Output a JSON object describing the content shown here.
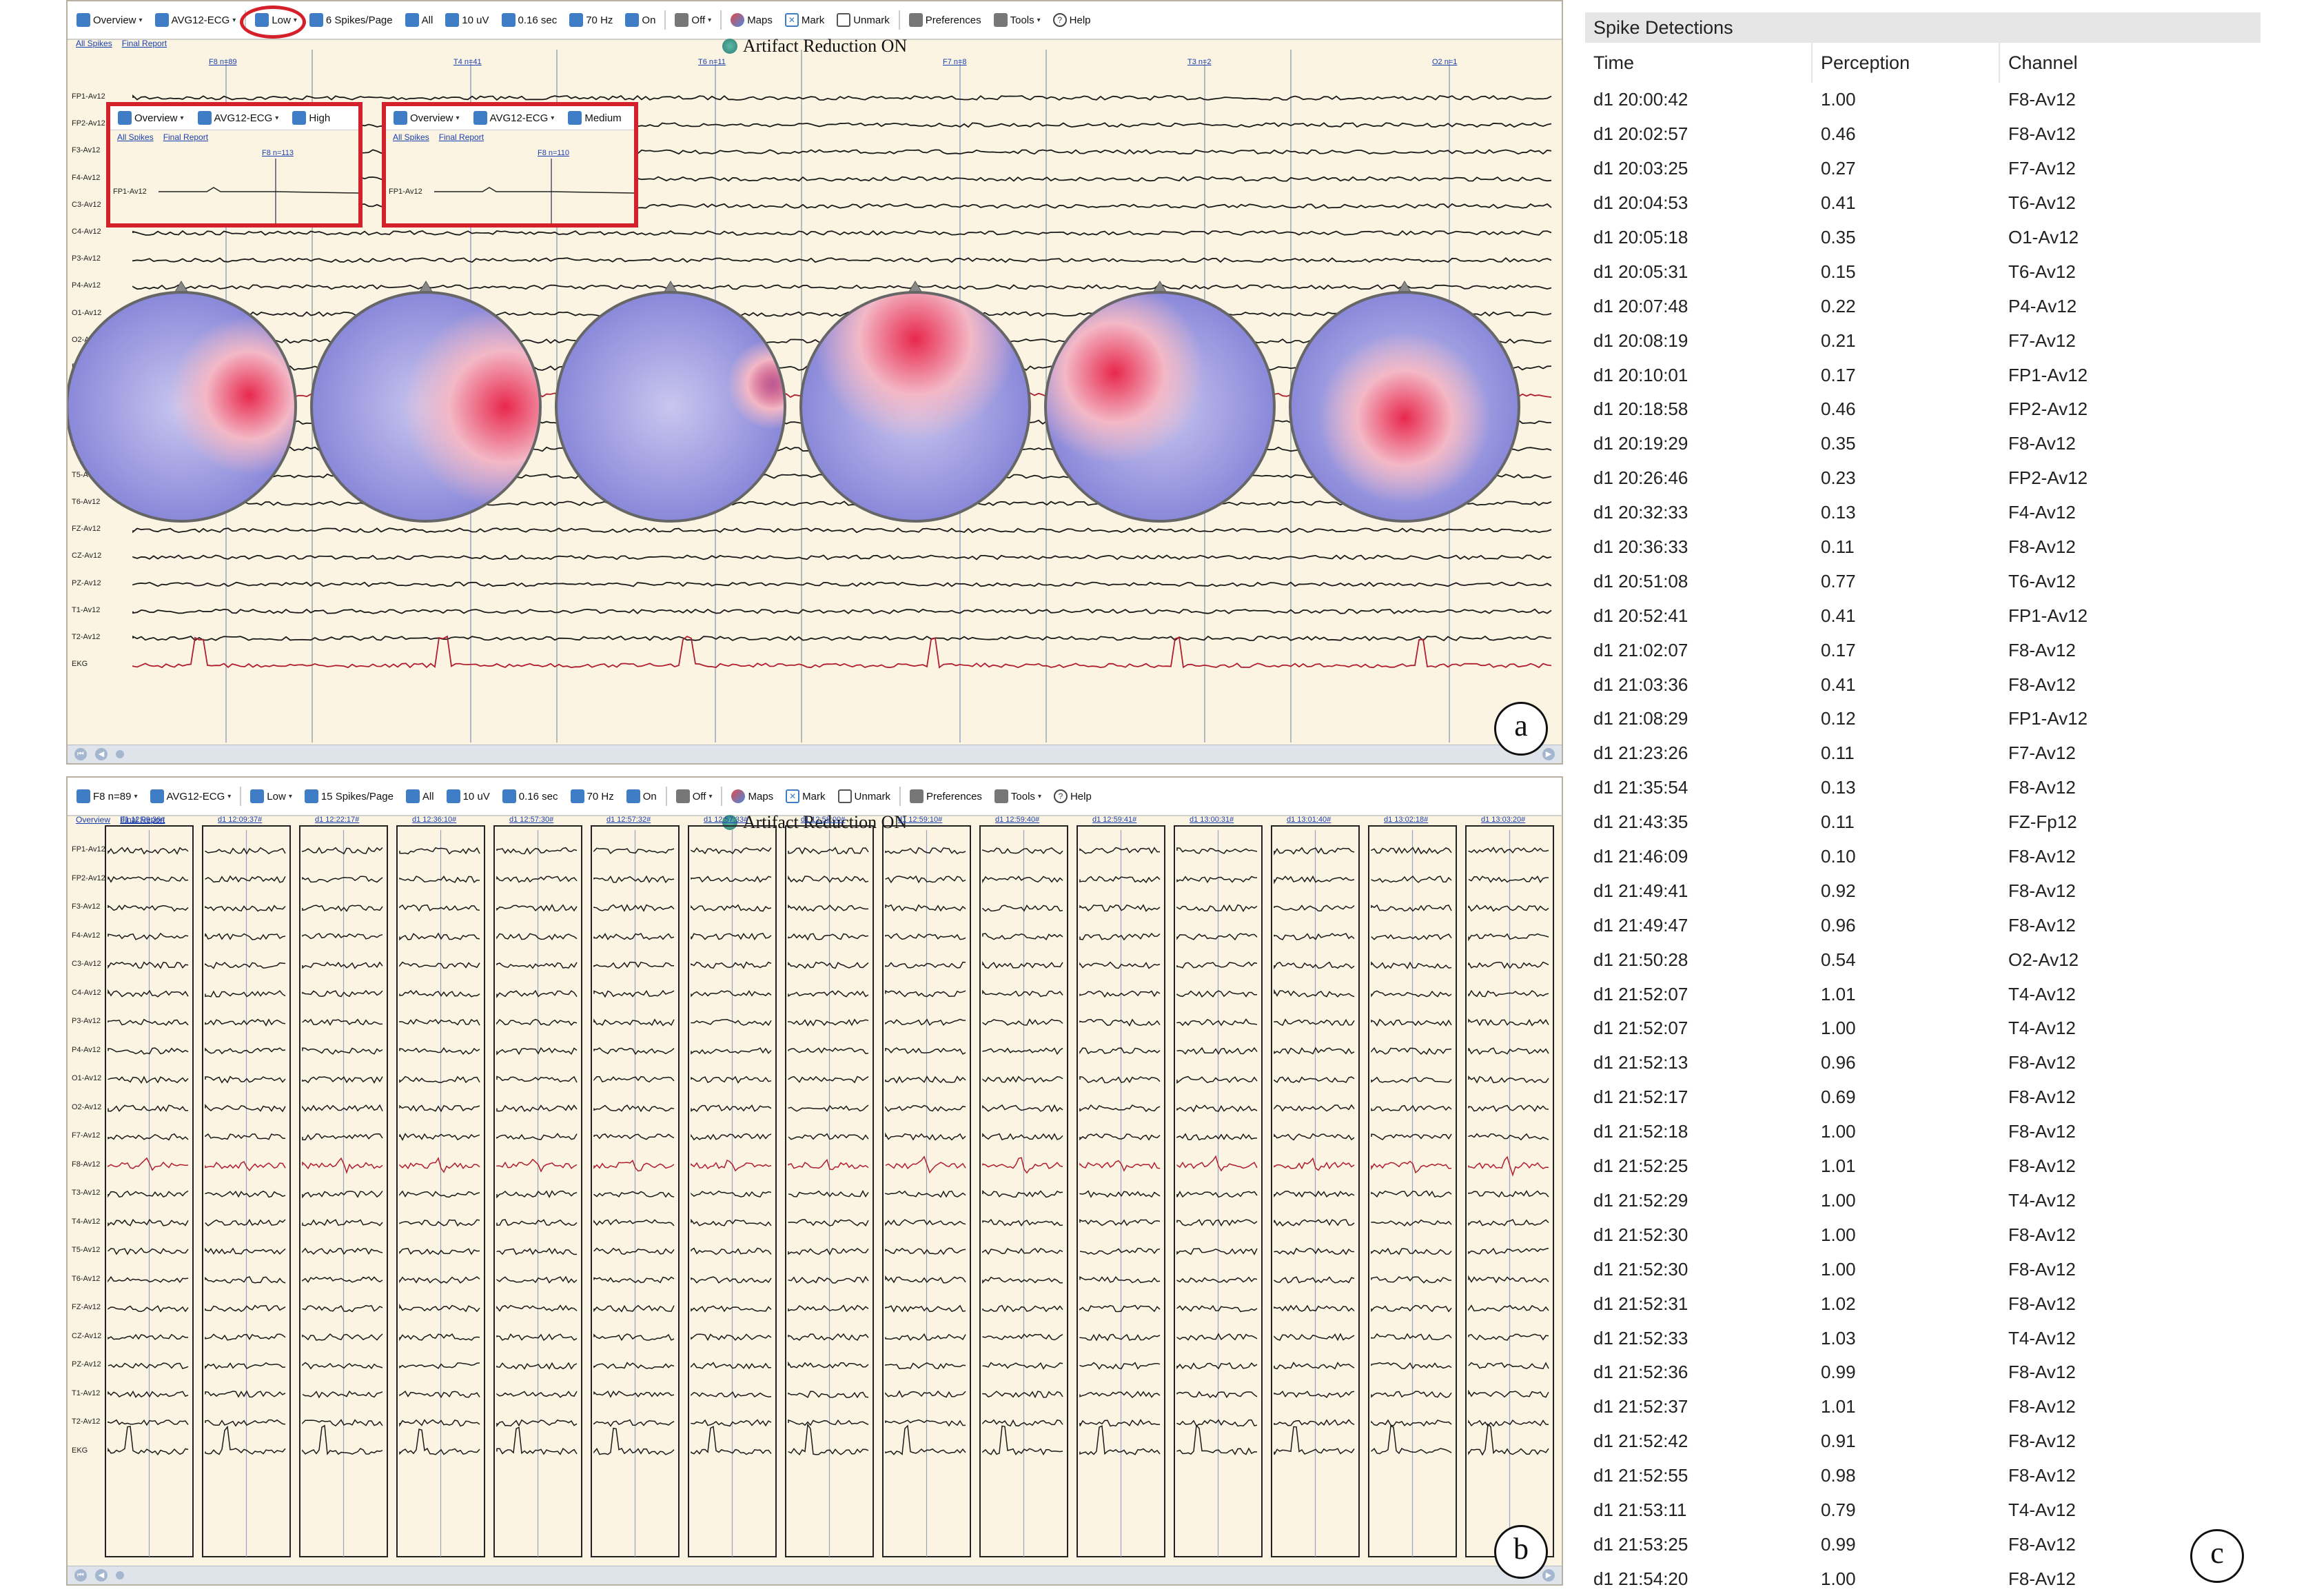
{
  "panel_a": {
    "toolbar": [
      {
        "label": "Overview",
        "icon": "overview-icon",
        "dd": true
      },
      {
        "label": "AVG12-ECG",
        "icon": "montage-icon",
        "dd": true
      },
      {
        "label": "Low",
        "icon": "sensitivity-icon",
        "dd": true
      },
      {
        "label": "6 Spikes/Page",
        "icon": "spikes-per-page-icon",
        "dd": false
      },
      {
        "label": "All",
        "icon": "all-icon",
        "dd": false
      },
      {
        "label": "10 uV",
        "icon": "gain-icon",
        "dd": false
      },
      {
        "label": "0.16 sec",
        "icon": "lff-icon",
        "dd": false
      },
      {
        "label": "70 Hz",
        "icon": "hff-icon",
        "dd": false
      },
      {
        "label": "On",
        "icon": "notch-icon",
        "dd": false
      },
      {
        "label": "Off",
        "icon": "artifact-icon",
        "dd": true
      },
      {
        "label": "Maps",
        "icon": "maps-icon",
        "dd": false
      },
      {
        "label": "Mark",
        "icon": "mark-icon",
        "dd": false
      },
      {
        "label": "Unmark",
        "icon": "unmark-icon",
        "dd": false
      },
      {
        "label": "Preferences",
        "icon": "gear-icon",
        "dd": false
      },
      {
        "label": "Tools",
        "icon": "tools-icon",
        "dd": true
      },
      {
        "label": "Help",
        "icon": "help-icon",
        "dd": false
      }
    ],
    "links": [
      "All Spikes",
      "Final Report"
    ],
    "artifact_text": "Artifact Reduction ON",
    "spike_heads": [
      "F8 n=89",
      "T4 n=41",
      "T6 n=11",
      "F7 n=8",
      "T3 n=2",
      "O2 n=1"
    ],
    "channels": [
      "FP1-Av12",
      "FP2-Av12",
      "F3-Av12",
      "F4-Av12",
      "C3-Av12",
      "C4-Av12",
      "P3-Av12",
      "P4-Av12",
      "O1-Av12",
      "O2-Av12",
      "F7-Av12",
      "F8-Av12",
      "T3-Av12",
      "T4-Av12",
      "T5-Av12",
      "T6-Av12",
      "FZ-Av12",
      "CZ-Av12",
      "PZ-Av12",
      "T1-Av12",
      "T2-Av12",
      "EKG"
    ],
    "corner_label": "a",
    "popups": [
      {
        "toolbar": [
          "Overview",
          "AVG12-ECG",
          "High"
        ],
        "links": [
          "All Spikes",
          "Final Report"
        ],
        "head": "F8 n=113",
        "ch": "FP1-Av12"
      },
      {
        "toolbar": [
          "Overview",
          "AVG12-ECG",
          "Medium"
        ],
        "links": [
          "All Spikes",
          "Final Report"
        ],
        "head": "F8 n=110",
        "ch": "FP1-Av12"
      }
    ],
    "maps": [
      {
        "type": "right-red"
      },
      {
        "type": "right-red-strong"
      },
      {
        "type": "blue-dominant"
      },
      {
        "type": "frontal-red"
      },
      {
        "type": "left-red"
      },
      {
        "type": "center-red"
      }
    ]
  },
  "panel_b": {
    "toolbar": [
      {
        "label": "F8 n=89",
        "icon": "overview-icon",
        "dd": true
      },
      {
        "label": "AVG12-ECG",
        "icon": "montage-icon",
        "dd": true
      },
      {
        "label": "Low",
        "icon": "sensitivity-icon",
        "dd": true
      },
      {
        "label": "15 Spikes/Page",
        "icon": "spikes-per-page-icon",
        "dd": false
      },
      {
        "label": "All",
        "icon": "all-icon",
        "dd": false
      },
      {
        "label": "10 uV",
        "icon": "gain-icon",
        "dd": false
      },
      {
        "label": "0.16 sec",
        "icon": "lff-icon",
        "dd": false
      },
      {
        "label": "70 Hz",
        "icon": "hff-icon",
        "dd": false
      },
      {
        "label": "On",
        "icon": "notch-icon",
        "dd": false
      },
      {
        "label": "Off",
        "icon": "artifact-icon",
        "dd": true
      },
      {
        "label": "Maps",
        "icon": "maps-icon",
        "dd": false
      },
      {
        "label": "Mark",
        "icon": "mark-icon",
        "dd": false
      },
      {
        "label": "Unmark",
        "icon": "unmark-icon",
        "dd": false
      },
      {
        "label": "Preferences",
        "icon": "gear-icon",
        "dd": false
      },
      {
        "label": "Tools",
        "icon": "tools-icon",
        "dd": true
      },
      {
        "label": "Help",
        "icon": "help-icon",
        "dd": false
      }
    ],
    "links": [
      "Overview",
      "Final Report"
    ],
    "artifact_text": "Artifact Reduction ON",
    "column_times": [
      "d1 12:09:36#",
      "d1 12:09:37#",
      "d1 12:22:17#",
      "d1 12:36:10#",
      "d1 12:57:30#",
      "d1 12:57:32#",
      "d1 12:57:33#",
      "d1 12:58:00#",
      "d1 12:59:10#",
      "d1 12:59:40#",
      "d1 12:59:41#",
      "d1 13:00:31#",
      "d1 13:01:40#",
      "d1 13:02:18#",
      "d1 13:03:20#"
    ],
    "channels": [
      "FP1-Av12",
      "FP2-Av12",
      "F3-Av12",
      "F4-Av12",
      "C3-Av12",
      "C4-Av12",
      "P3-Av12",
      "P4-Av12",
      "O1-Av12",
      "O2-Av12",
      "F7-Av12",
      "F8-Av12",
      "T3-Av12",
      "T4-Av12",
      "T5-Av12",
      "T6-Av12",
      "FZ-Av12",
      "CZ-Av12",
      "PZ-Av12",
      "T1-Av12",
      "T2-Av12",
      "EKG"
    ],
    "corner_label": "b"
  },
  "spike_table": {
    "title": "Spike Detections",
    "headers": [
      "Time",
      "Perception",
      "Channel"
    ],
    "corner_label": "c",
    "rows": [
      [
        "d1 20:00:42",
        "1.00",
        "F8-Av12"
      ],
      [
        "d1 20:02:57",
        "0.46",
        "F8-Av12"
      ],
      [
        "d1 20:03:25",
        "0.27",
        "F7-Av12"
      ],
      [
        "d1 20:04:53",
        "0.41",
        "T6-Av12"
      ],
      [
        "d1 20:05:18",
        "0.35",
        "O1-Av12"
      ],
      [
        "d1 20:05:31",
        "0.15",
        "T6-Av12"
      ],
      [
        "d1 20:07:48",
        "0.22",
        "P4-Av12"
      ],
      [
        "d1 20:08:19",
        "0.21",
        "F7-Av12"
      ],
      [
        "d1 20:10:01",
        "0.17",
        "FP1-Av12"
      ],
      [
        "d1 20:18:58",
        "0.46",
        "FP2-Av12"
      ],
      [
        "d1 20:19:29",
        "0.35",
        "F8-Av12"
      ],
      [
        "d1 20:26:46",
        "0.23",
        "FP2-Av12"
      ],
      [
        "d1 20:32:33",
        "0.13",
        "F4-Av12"
      ],
      [
        "d1 20:36:33",
        "0.11",
        "F8-Av12"
      ],
      [
        "d1 20:51:08",
        "0.77",
        "T6-Av12"
      ],
      [
        "d1 20:52:41",
        "0.41",
        "FP1-Av12"
      ],
      [
        "d1 21:02:07",
        "0.17",
        "F8-Av12"
      ],
      [
        "d1 21:03:36",
        "0.41",
        "F8-Av12"
      ],
      [
        "d1 21:08:29",
        "0.12",
        "FP1-Av12"
      ],
      [
        "d1 21:23:26",
        "0.11",
        "F7-Av12"
      ],
      [
        "d1 21:35:54",
        "0.13",
        "F8-Av12"
      ],
      [
        "d1 21:43:35",
        "0.11",
        "FZ-Fp12"
      ],
      [
        "d1 21:46:09",
        "0.10",
        "F8-Av12"
      ],
      [
        "d1 21:49:41",
        "0.92",
        "F8-Av12"
      ],
      [
        "d1 21:49:47",
        "0.96",
        "F8-Av12"
      ],
      [
        "d1 21:50:28",
        "0.54",
        "O2-Av12"
      ],
      [
        "d1 21:52:07",
        "1.01",
        "T4-Av12"
      ],
      [
        "d1 21:52:07",
        "1.00",
        "T4-Av12"
      ],
      [
        "d1 21:52:13",
        "0.96",
        "F8-Av12"
      ],
      [
        "d1 21:52:17",
        "0.69",
        "F8-Av12"
      ],
      [
        "d1 21:52:18",
        "1.00",
        "F8-Av12"
      ],
      [
        "d1 21:52:25",
        "1.01",
        "F8-Av12"
      ],
      [
        "d1 21:52:29",
        "1.00",
        "T4-Av12"
      ],
      [
        "d1 21:52:30",
        "1.00",
        "F8-Av12"
      ],
      [
        "d1 21:52:30",
        "1.00",
        "F8-Av12"
      ],
      [
        "d1 21:52:31",
        "1.02",
        "F8-Av12"
      ],
      [
        "d1 21:52:33",
        "1.03",
        "T4-Av12"
      ],
      [
        "d1 21:52:36",
        "0.99",
        "F8-Av12"
      ],
      [
        "d1 21:52:37",
        "1.01",
        "F8-Av12"
      ],
      [
        "d1 21:52:42",
        "0.91",
        "F8-Av12"
      ],
      [
        "d1 21:52:55",
        "0.98",
        "F8-Av12"
      ],
      [
        "d1 21:53:11",
        "0.79",
        "T4-Av12"
      ],
      [
        "d1 21:53:25",
        "0.99",
        "F8-Av12"
      ],
      [
        "d1 21:54:20",
        "1.00",
        "F8-Av12"
      ]
    ]
  },
  "colors": {
    "panel_bg": "#fbf4e2",
    "trace": "#1a1a1a",
    "trace_red": "#b01e2e",
    "highlight_red": "#d4202a",
    "link_blue": "#1b3fae"
  }
}
